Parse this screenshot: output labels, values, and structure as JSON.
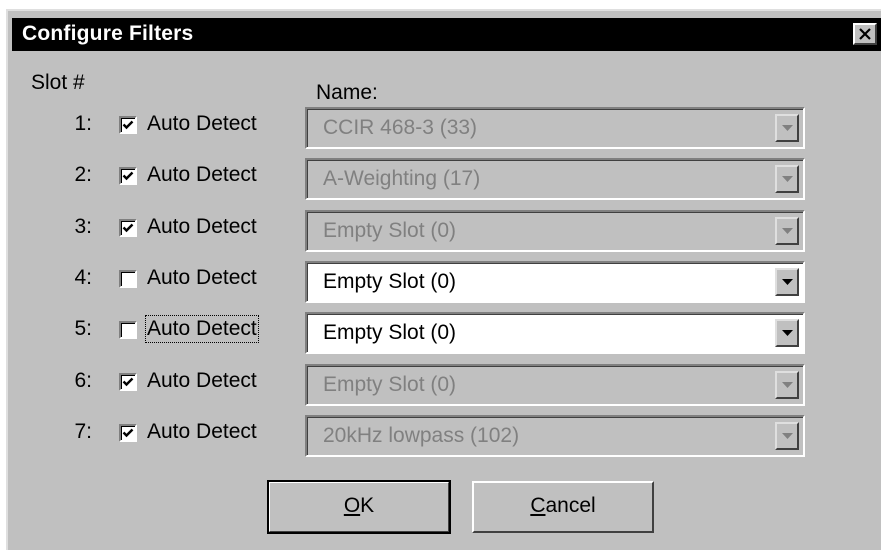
{
  "dialog": {
    "title": "Configure Filters",
    "close_glyph": "✕"
  },
  "headers": {
    "slot": "Slot #",
    "name": "Name:"
  },
  "rows": [
    {
      "slot": "1:",
      "auto_label": "Auto Detect",
      "checked": true,
      "filter": "CCIR 468-3 (33)",
      "enabled": false
    },
    {
      "slot": "2:",
      "auto_label": "Auto Detect",
      "checked": true,
      "filter": "A-Weighting (17)",
      "enabled": false
    },
    {
      "slot": "3:",
      "auto_label": "Auto Detect",
      "checked": true,
      "filter": "Empty Slot (0)",
      "enabled": false
    },
    {
      "slot": "4:",
      "auto_label": "Auto Detect",
      "checked": false,
      "filter": "Empty Slot (0)",
      "enabled": true
    },
    {
      "slot": "5:",
      "auto_label": "Auto Detect",
      "checked": false,
      "filter": "Empty Slot (0)",
      "enabled": true,
      "focused": true
    },
    {
      "slot": "6:",
      "auto_label": "Auto Detect",
      "checked": true,
      "filter": "Empty Slot (0)",
      "enabled": false
    },
    {
      "slot": "7:",
      "auto_label": "Auto Detect",
      "checked": true,
      "filter": "20kHz lowpass (102)",
      "enabled": false
    }
  ],
  "buttons": {
    "ok": {
      "accel": "O",
      "rest": "K"
    },
    "cancel": {
      "accel": "C",
      "rest": "ancel"
    }
  },
  "icons": {
    "close": "close-icon",
    "checkmark": "checkmark-icon",
    "dropdown": "chevron-down-icon"
  },
  "colors": {
    "title_bar": "#000000",
    "face": "#c0c0c0",
    "disabled_text": "#808080"
  }
}
